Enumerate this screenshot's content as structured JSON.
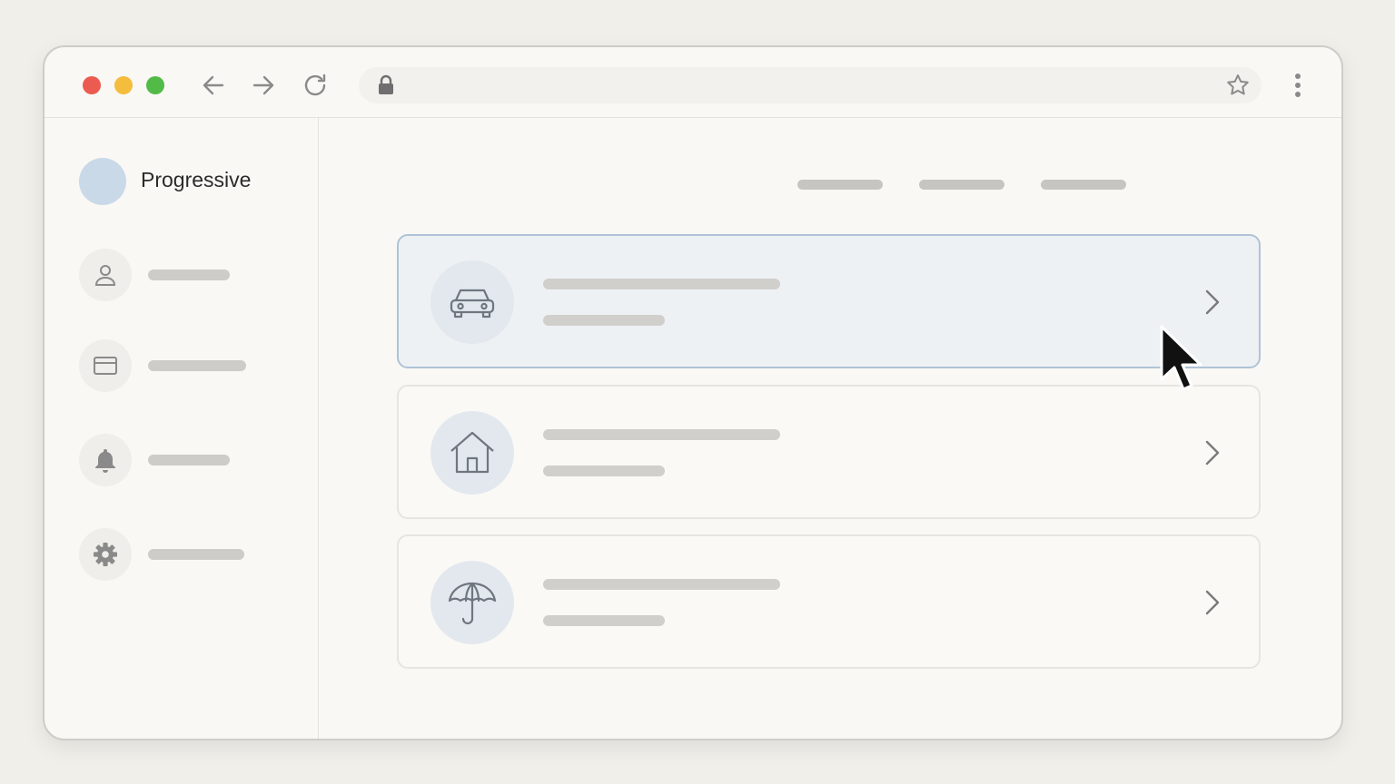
{
  "browser": {
    "window_controls": [
      "close",
      "minimize",
      "maximize"
    ],
    "icons": {
      "back": "arrow-left-icon",
      "forward": "arrow-right-icon",
      "reload": "reload-icon",
      "lock": "lock-icon",
      "bookmark": "star-icon",
      "menu": "kebab-menu-icon"
    }
  },
  "sidebar": {
    "brand_name": "Progressive",
    "items": [
      {
        "icon": "user-icon"
      },
      {
        "icon": "credit-card-icon"
      },
      {
        "icon": "bell-icon"
      },
      {
        "icon": "gear-icon"
      }
    ]
  },
  "main": {
    "cards": [
      {
        "icon": "car-icon",
        "active": true
      },
      {
        "icon": "house-icon",
        "active": false
      },
      {
        "icon": "umbrella-icon",
        "active": false
      }
    ]
  },
  "colors": {
    "background": "#f1efea",
    "window": "#f9f8f5",
    "active_card": "#eef1f4",
    "active_border": "#afc3d6",
    "brand_logo": "#c9d9e8",
    "close": "#ec5b4f",
    "minimize": "#f4bd3e",
    "maximize": "#52bb48"
  }
}
